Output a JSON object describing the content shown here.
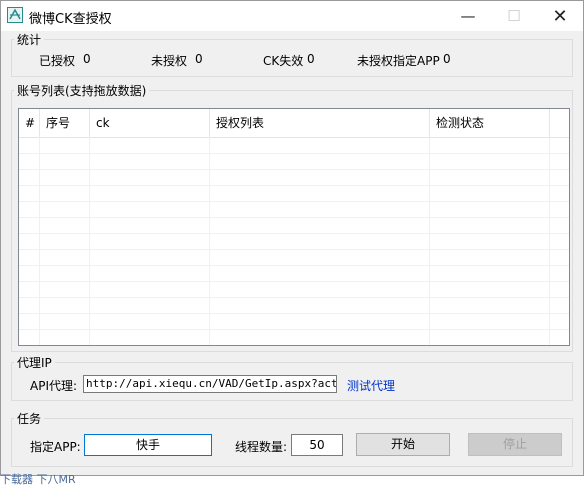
{
  "window": {
    "title": "微博CK查授权",
    "minimize_glyph": "—",
    "maximize_glyph": "☐",
    "close_glyph": "✕"
  },
  "stats": {
    "legend": "统计",
    "items": [
      {
        "label": "已授权",
        "value": "0"
      },
      {
        "label": "未授权",
        "value": "0"
      },
      {
        "label": "CK失效",
        "value": "0"
      },
      {
        "label": "未授权指定APP",
        "value": "0"
      }
    ]
  },
  "account_list": {
    "legend": "账号列表(支持拖放数据)",
    "columns": [
      "#",
      "序号",
      "ck",
      "授权列表",
      "检测状态"
    ]
  },
  "proxy": {
    "legend": "代理IP",
    "api_label": "API代理:",
    "api_value": "http://api.xiequ.cn/VAD/GetIp.aspx?act=get",
    "test_link": "测试代理"
  },
  "task": {
    "legend": "任务",
    "app_label": "指定APP:",
    "app_value": "快手",
    "threads_label": "线程数量:",
    "threads_value": "50",
    "start_label": "开始",
    "stop_label": "停止"
  },
  "footer_overflow_text": "下载器 下八MR"
}
